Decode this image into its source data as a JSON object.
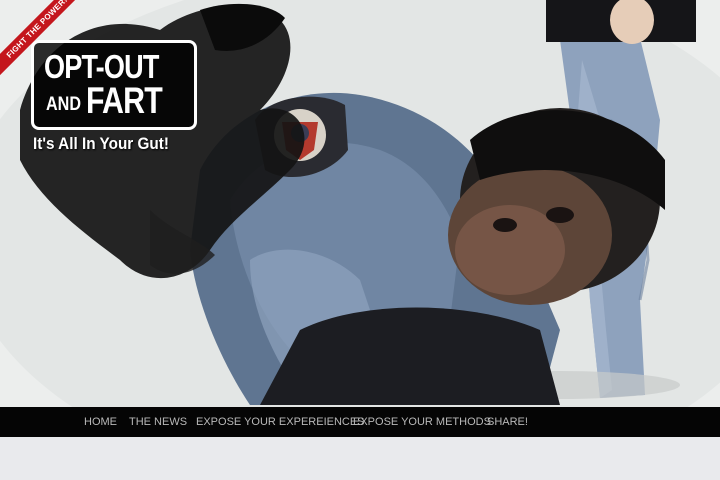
{
  "ribbon": {
    "text": "FIGHT THE POWER!"
  },
  "logo": {
    "line1": "OPT-OUT",
    "and": "AND",
    "fart": "FART",
    "tagline": "It's All In Your Gut!"
  },
  "nav": {
    "items": [
      {
        "label": "HOME"
      },
      {
        "label": "THE NEWS"
      },
      {
        "label": "EXPOSE YOUR EXPEREIENCES"
      },
      {
        "label": "EXPOSE YOUR METHODS"
      },
      {
        "label": "SHARE!"
      }
    ]
  },
  "colors": {
    "nav_background": "#050505",
    "nav_text": "#b9b9b9",
    "ribbon": "#c4161c",
    "page_background": "#e9eaed"
  }
}
